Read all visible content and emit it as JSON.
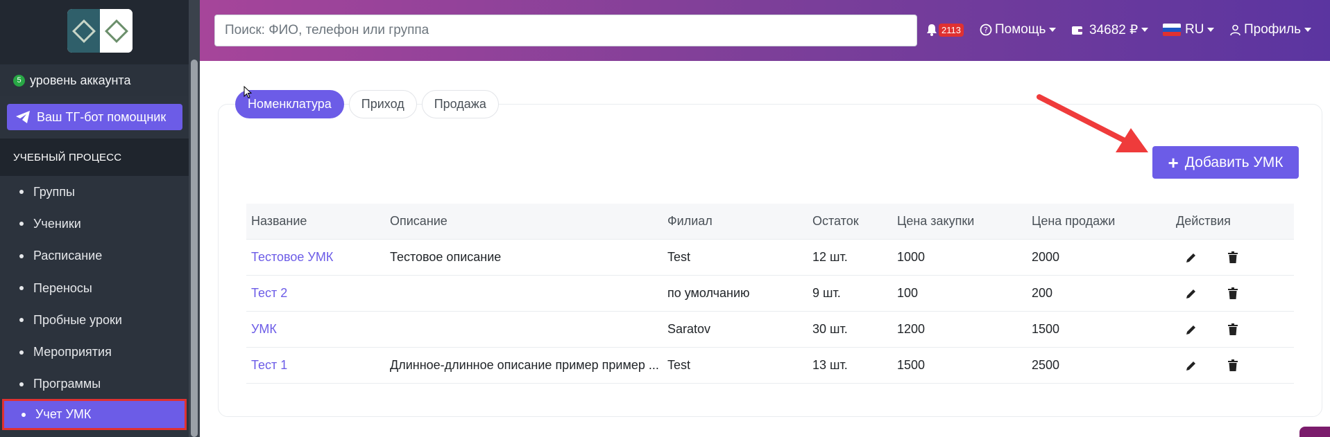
{
  "sidebar": {
    "level_badge": "5",
    "level_text": "уровень аккаунта",
    "tg_button": "Ваш ТГ-бот помощник",
    "section": "УЧЕБНЫЙ ПРОЦЕСС",
    "items": [
      {
        "label": "Группы"
      },
      {
        "label": "Ученики"
      },
      {
        "label": "Расписание"
      },
      {
        "label": "Переносы"
      },
      {
        "label": "Пробные уроки"
      },
      {
        "label": "Мероприятия"
      },
      {
        "label": "Программы"
      },
      {
        "label": "Учет УМК"
      }
    ],
    "active_index": 7
  },
  "header": {
    "search_placeholder": "Поиск: ФИО, телефон или группа",
    "notifications": "2113",
    "help": "Помощь",
    "balance": "34682 ₽",
    "language": "RU",
    "profile": "Профиль"
  },
  "tabs": [
    {
      "label": "Номенклатура",
      "active": true
    },
    {
      "label": "Приход",
      "active": false
    },
    {
      "label": "Продажа",
      "active": false
    }
  ],
  "add_button": "Добавить УМК",
  "table": {
    "headers": [
      "Название",
      "Описание",
      "Филиал",
      "Остаток",
      "Цена закупки",
      "Цена продажи",
      "Действия"
    ],
    "rows": [
      [
        "Тестовое УМК",
        "Тестовое описание",
        "Test",
        "12 шт.",
        "1000",
        "2000"
      ],
      [
        "Тест 2",
        "",
        "по умолчанию",
        "9 шт.",
        "100",
        "200"
      ],
      [
        "УМК",
        "",
        "Saratov",
        "30 шт.",
        "1200",
        "1500"
      ],
      [
        "Тест 1",
        "Длинное-длинное описание пример пример ...",
        "Test",
        "13 шт.",
        "1500",
        "2500"
      ]
    ]
  },
  "colors": {
    "accent": "#6c5ce7",
    "sidebar_bg": "#2c333d",
    "header_gradient_start": "#a6459a",
    "header_gradient_end": "#5b35a0",
    "highlight_red": "#e03131"
  },
  "icons": {
    "notification": "bell-icon",
    "help": "question-circle-icon",
    "balance": "wallet-icon",
    "profile": "user-icon",
    "tg": "telegram-icon",
    "edit": "pencil-icon",
    "delete": "trash-icon"
  }
}
